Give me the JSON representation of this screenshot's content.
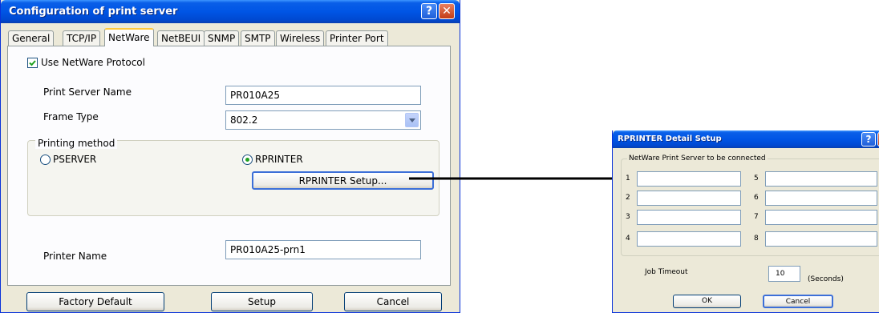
{
  "main": {
    "title": "Configuration of print server",
    "tabs": [
      "General",
      "TCP/IP",
      "NetWare",
      "NetBEUI",
      "SNMP",
      "SMTP",
      "Wireless",
      "Printer Port"
    ],
    "use_protocol_label": "Use NetWare Protocol",
    "use_protocol_checked": true,
    "print_server_name_label": "Print Server Name",
    "print_server_name_value": "PR010A25",
    "frame_type_label": "Frame Type",
    "frame_type_value": "802.2",
    "printing_method_label": "Printing method",
    "pserver_label": "PSERVER",
    "rprinter_label": "RPRINTER",
    "selected_method": "RPRINTER",
    "rprinter_setup_label": "RPRINTER Setup...",
    "printer_name_label": "Printer Name",
    "printer_name_value": "PR010A25-prn1",
    "factory_default_label": "Factory Default",
    "setup_label": "Setup",
    "cancel_label": "Cancel"
  },
  "detail": {
    "title": "RPRINTER Detail Setup",
    "group_label": "NetWare Print Server to be connected",
    "slots": [
      "1",
      "2",
      "3",
      "4",
      "5",
      "6",
      "7",
      "8"
    ],
    "job_timeout_label": "Job Timeout",
    "job_timeout_value": "10",
    "seconds_label": "(Seconds)",
    "ok_label": "OK",
    "cancel_label": "Cancel"
  },
  "colors": {
    "titlebar": "#0055e5",
    "window_bg": "#ece9d8",
    "checkmark": "#21a121",
    "active_tab": "#ffc83c"
  }
}
